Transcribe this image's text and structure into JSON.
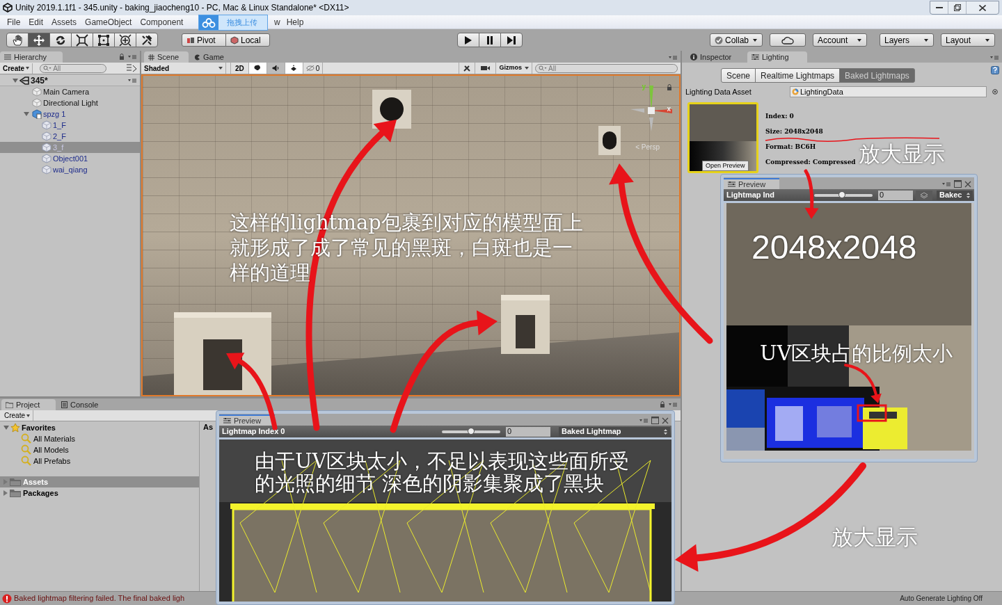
{
  "window": {
    "title": "Unity 2019.1.1f1 - 345.unity - baking_jiaocheng10 - PC, Mac & Linux Standalone* <DX11>"
  },
  "menu": [
    "File",
    "Edit",
    "Assets",
    "GameObject",
    "Component",
    "w",
    "Help"
  ],
  "upload_popup": {
    "label": "拖拽上传"
  },
  "toolbar": {
    "tools": [
      {
        "kind": "hand",
        "selected": false
      },
      {
        "kind": "move",
        "selected": true
      },
      {
        "kind": "rotate",
        "selected": false
      },
      {
        "kind": "scale",
        "selected": false
      },
      {
        "kind": "rect",
        "selected": false
      },
      {
        "kind": "transform",
        "selected": false
      },
      {
        "kind": "custom",
        "selected": false
      }
    ],
    "pivot": "Pivot",
    "local": "Local",
    "collab": "Collab",
    "account": "Account",
    "layers": "Layers",
    "layout": "Layout"
  },
  "hierarchy": {
    "tab": "Hierarchy",
    "create": "Create",
    "search_placeholder": "All",
    "scene": "345*",
    "items": [
      {
        "label": "Main Camera",
        "kind": "object",
        "selected": false
      },
      {
        "label": "Directional Light",
        "kind": "object",
        "selected": false
      },
      {
        "label": "spzg 1",
        "kind": "prefab_root",
        "selected": false,
        "expanded": true,
        "children": [
          {
            "label": "1_F",
            "kind": "prefab",
            "selected": false
          },
          {
            "label": "2_F",
            "kind": "prefab",
            "selected": false
          },
          {
            "label": "3_f",
            "kind": "prefab",
            "selected": true
          },
          {
            "label": "Object001",
            "kind": "prefab",
            "selected": false
          },
          {
            "label": "wai_qiang",
            "kind": "prefab",
            "selected": false
          }
        ]
      }
    ]
  },
  "scene_view": {
    "tabs": [
      {
        "label": "Scene",
        "selected": true
      },
      {
        "label": "Game",
        "selected": false
      }
    ],
    "shading": "Shaded",
    "mode_2d": "2D",
    "toggles": [
      {
        "kind": "lighting",
        "on": true
      },
      {
        "kind": "audio",
        "on": false
      },
      {
        "kind": "effects",
        "on": true
      }
    ],
    "hidden_count": "0",
    "gizmos": "Gizmos",
    "search_placeholder": "All",
    "axes": [
      "y",
      "x"
    ],
    "view_label": "< Persp"
  },
  "inspector": {
    "tabs": [
      {
        "label": "Inspector",
        "selected": false
      },
      {
        "label": "Lighting",
        "selected": true
      }
    ],
    "modes": [
      {
        "label": "Scene",
        "selected": false
      },
      {
        "label": "Realtime Lightmaps",
        "selected": false
      },
      {
        "label": "Baked Lightmaps",
        "selected": true
      }
    ],
    "data_asset_label": "Lighting Data Asset",
    "data_asset_value": "LightingData",
    "open_preview": "Open Preview",
    "info": [
      "Index: 0",
      "Size: 2048x2048",
      "Format: BC6H",
      "Compressed: Compressed"
    ]
  },
  "project": {
    "tabs": [
      {
        "label": "Project",
        "selected": true
      },
      {
        "label": "Console",
        "selected": false
      }
    ],
    "create": "Create",
    "favorites": {
      "label": "Favorites",
      "expanded": true,
      "children": [
        "All Materials",
        "All Models",
        "All Prefabs"
      ]
    },
    "folders": [
      {
        "label": "Assets",
        "selected": true
      },
      {
        "label": "Packages",
        "selected": false
      }
    ],
    "column_header": "As"
  },
  "preview_windows": [
    {
      "tab": "Preview",
      "index_label": "Lightmap Ind",
      "level": 0.48,
      "value": "0",
      "mode": "Bakec"
    },
    {
      "tab": "Preview",
      "index_label": "Lightmap Index 0",
      "level": 0.5,
      "value": "0",
      "mode": "Baked Lightmap"
    }
  ],
  "annotations": [
    {
      "text": "这样的lightmap包裹到对应的模型面上"
    },
    {
      "text": "就形成了成了常见的黑斑，白斑也是一"
    },
    {
      "text": "样的道理"
    },
    {
      "text": "放大显示"
    },
    {
      "text": "2048x2048"
    },
    {
      "text": "UV区块占的比例太小"
    },
    {
      "text": "由于UV区块太小，不足以表现这些面所受"
    },
    {
      "text": "的光照的细节 深色的阴影集聚成了黑块"
    },
    {
      "text": "放大显示"
    }
  ],
  "status_bar": {
    "error": "Baked lightmap filtering failed. The final baked ligh",
    "lighting": "Auto Generate Lighting Off"
  }
}
